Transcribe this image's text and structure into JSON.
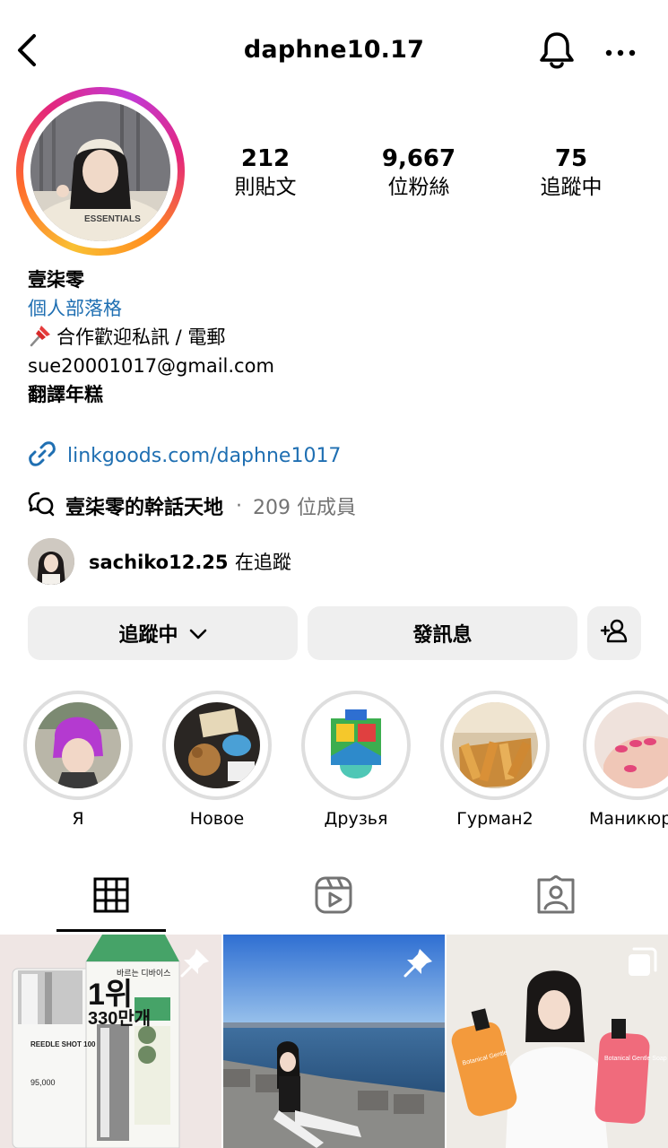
{
  "header": {
    "username": "daphne10.17"
  },
  "stats": [
    {
      "value": "212",
      "label": "則貼文"
    },
    {
      "value": "9,667",
      "label": "位粉絲"
    },
    {
      "value": "75",
      "label": "追蹤中"
    }
  ],
  "bio": {
    "name": "壹柒零",
    "category_link": "個人部落格",
    "line1": "合作歡迎私訊 / 電郵",
    "email": "sue20001017@gmail.com",
    "line3": "翻譯年糕"
  },
  "external_link": "linkgoods.com/daphne1017",
  "channel": {
    "name": "壹柒零的幹話天地",
    "separator": "·",
    "members": "209 位成員"
  },
  "followed_by": {
    "username": "sachiko12.25",
    "suffix": "在追蹤"
  },
  "actions": {
    "following_label": "追蹤中",
    "message_label": "發訊息"
  },
  "highlights": [
    {
      "label": "Я"
    },
    {
      "label": "Новое"
    },
    {
      "label": "Друзья"
    },
    {
      "label": "Гурман2"
    },
    {
      "label": "Маникюр"
    }
  ],
  "posts": [
    {
      "pinned": true,
      "ko_text_1": "바르는 디바이스",
      "ko_text_2": "1위",
      "ko_text_3": "330만개",
      "product": "REEDLE SHOT 100",
      "price": "95,000"
    },
    {
      "pinned": true
    },
    {
      "multi": true,
      "bottle_1": "Botanical Gentle",
      "bottle_2": "Botanical Gentle Soap"
    }
  ],
  "colors": {
    "link": "#1f6fb2",
    "button_bg": "#efefef",
    "secondary_text": "#737373"
  }
}
